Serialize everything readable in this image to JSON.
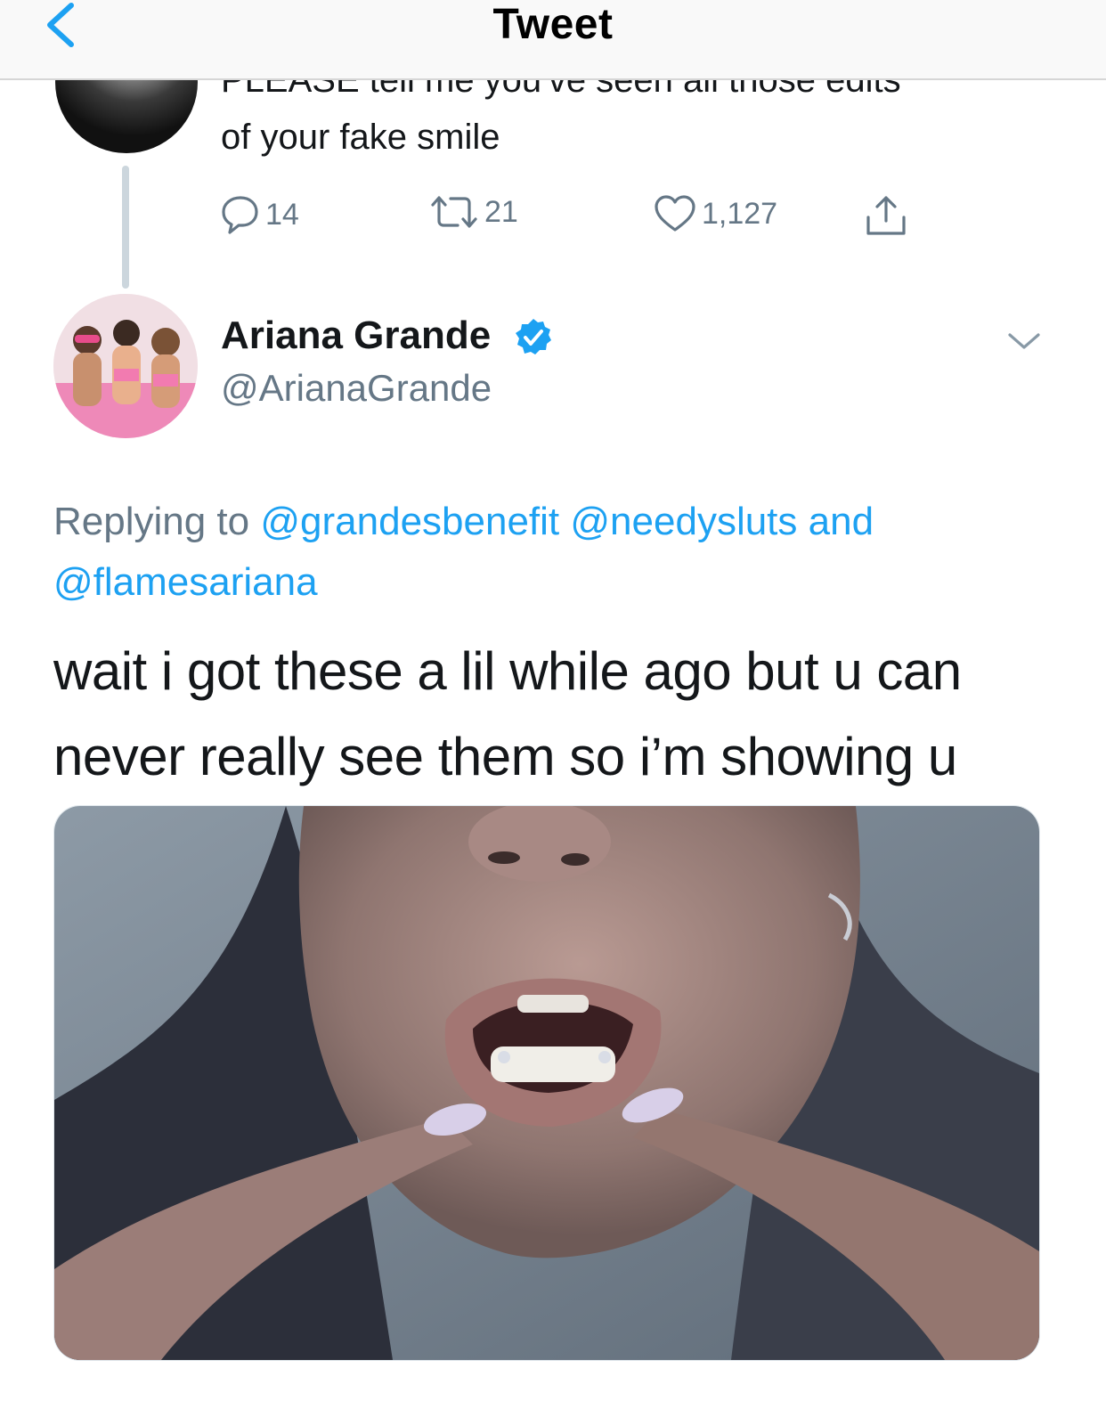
{
  "nav": {
    "title": "Tweet"
  },
  "previous_tweet": {
    "text": "PLEASE tell me you've seen all those edits\nof your fake smile",
    "replies": "14",
    "retweets": "21",
    "likes": "1,127"
  },
  "tweet": {
    "display_name": "Ariana Grande",
    "handle": "@ArianaGrande",
    "replying_prefix": "Replying to",
    "mentions": [
      "@grandesbenefit",
      "@needysluts"
    ],
    "replying_and": "and",
    "last_mention": "@flamesariana",
    "body": "wait i got these a lil while ago but u can never really see them so i’m showing u"
  },
  "colors": {
    "accent": "#1da1f2",
    "secondary_text": "#657786",
    "verified_badge": "#1da1f2"
  },
  "icons": [
    "back-chevron-icon",
    "reply-icon",
    "retweet-icon",
    "like-heart-icon",
    "share-icon",
    "verified-badge-icon",
    "more-chevron-icon"
  ]
}
